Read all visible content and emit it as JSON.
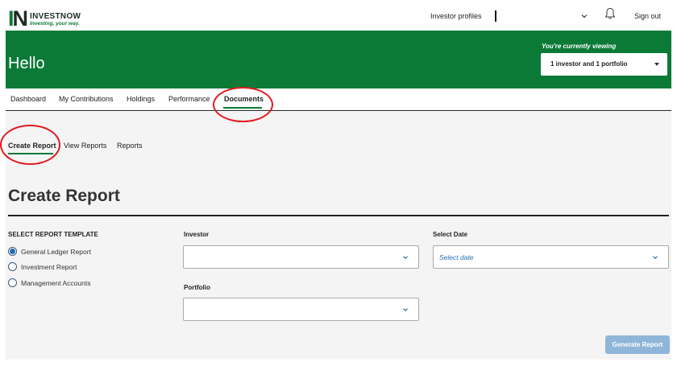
{
  "brand": {
    "mark_i": "I",
    "mark_n": "N",
    "name": "INVESTNOW",
    "tagline": "Investing, your way."
  },
  "topbar": {
    "profiles_label": "Investor profiles",
    "signout_label": "Sign out"
  },
  "hero": {
    "greeting": "Hello",
    "viewing_label": "You're currently viewing",
    "viewing_value": "1 investor and 1 portfolio"
  },
  "main_nav": {
    "items": [
      {
        "label": "Dashboard"
      },
      {
        "label": "My Contributions"
      },
      {
        "label": "Holdings"
      },
      {
        "label": "Performance"
      },
      {
        "label": "Documents"
      }
    ],
    "active": "Documents"
  },
  "sub_nav": {
    "items": [
      {
        "label": "Create Report"
      },
      {
        "label": "View Reports"
      },
      {
        "label": "Reports"
      }
    ],
    "active": "Create Report"
  },
  "page": {
    "title": "Create Report",
    "template_section_label": "SELECT REPORT TEMPLATE",
    "templates": [
      {
        "label": "General Ledger Report",
        "checked": true
      },
      {
        "label": "Investment Report",
        "checked": false
      },
      {
        "label": "Management Accounts",
        "checked": false
      }
    ],
    "investor_label": "Investor",
    "investor_value": "",
    "portfolio_label": "Portfolio",
    "portfolio_value": "",
    "date_label": "Select Date",
    "date_placeholder": "Select date",
    "generate_label": "Generate Report"
  },
  "colors": {
    "brand_green": "#0a7a36",
    "annotation_red": "#e0191f",
    "button_disabled_blue": "#8fb6d9",
    "radio_blue": "#1f6fb2"
  }
}
